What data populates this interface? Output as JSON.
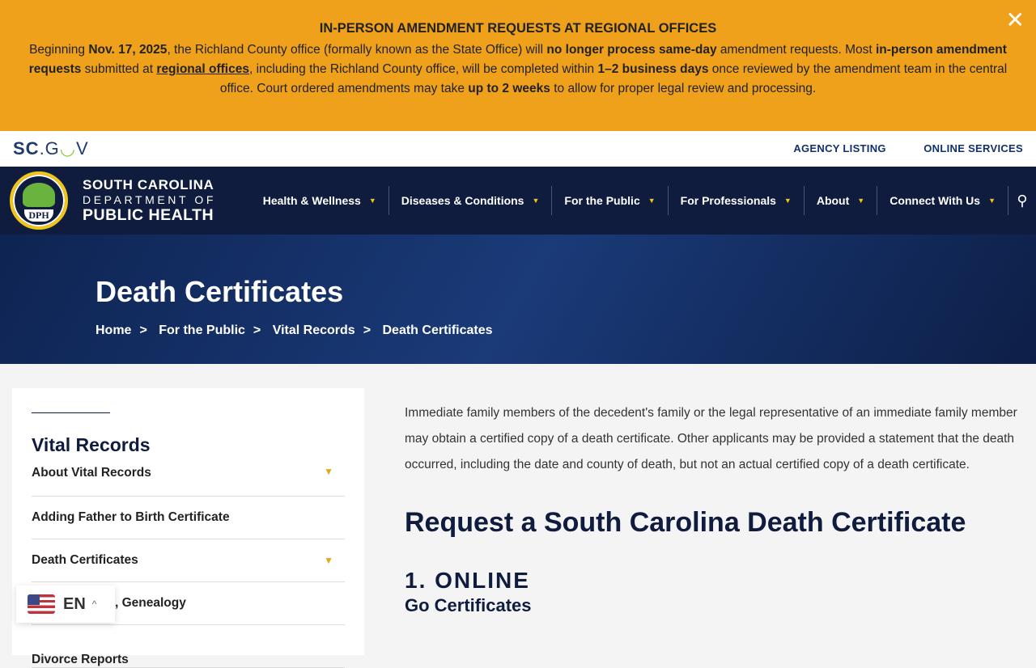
{
  "alert": {
    "title": "IN-PERSON AMENDMENT REQUESTS AT REGIONAL OFFICES",
    "p1": "Beginning ",
    "date": "Nov. 17, 2025",
    "p2": ", the Richland County office (formally known as the State Office) will ",
    "b1": "no longer process same-day",
    "p3": " amendment requests. Most ",
    "b2": "in-person amendment requests",
    "p4": " submitted at ",
    "link": "regional offices",
    "p5": ", including the Richland County office, will be completed within ",
    "b3": "1–2 business days",
    "p6": " once reviewed by the amendment team in the central office. Court ordered amendments may take ",
    "b4": "up to 2 weeks",
    "p7": " to allow for proper legal review and processing.",
    "close": "✕"
  },
  "topbar": {
    "sc": "SC",
    "gov1": ".G",
    "gov_o": "◡",
    "gov2": "V",
    "links": [
      "AGENCY LISTING",
      "ONLINE SERVICES"
    ]
  },
  "header": {
    "logo_text": "DPH",
    "org": [
      "SOUTH CAROLINA",
      "DEPARTMENT OF",
      "PUBLIC HEALTH"
    ],
    "menu": [
      "Health & Wellness",
      "Diseases & Conditions",
      "For the Public",
      "For Professionals",
      "About",
      "Connect With Us"
    ],
    "caret": "▼",
    "search": "⚲"
  },
  "hero": {
    "title": "Death Certificates",
    "breadcrumb": [
      "Home",
      "For the Public",
      "Vital Records",
      "Death Certificates"
    ],
    "sep": ">"
  },
  "sidebar": {
    "title": "Vital Records",
    "items": [
      {
        "label": "About Vital Records",
        "caret": "▼"
      },
      {
        "label": "Adding Father to Birth Certificate"
      },
      {
        "label": "Death Certificates",
        "caret": "▼"
      },
      {
        "label": ", Genealogy"
      },
      {
        "label": "Divorce Reports"
      }
    ]
  },
  "main": {
    "intro": "Immediate family members of the decedent's family or the legal representative of an immediate family member may obtain a certified copy of a death certificate. Other applicants may be provided a statement that the death occurred, including the date and county of death, but not an actual certified copy of a death certificate.",
    "heading": "Request a South Carolina Death Certificate",
    "step": "1. ONLINE",
    "sub": "Go Certificates"
  },
  "lang": {
    "code": "EN",
    "chevron": "^"
  }
}
